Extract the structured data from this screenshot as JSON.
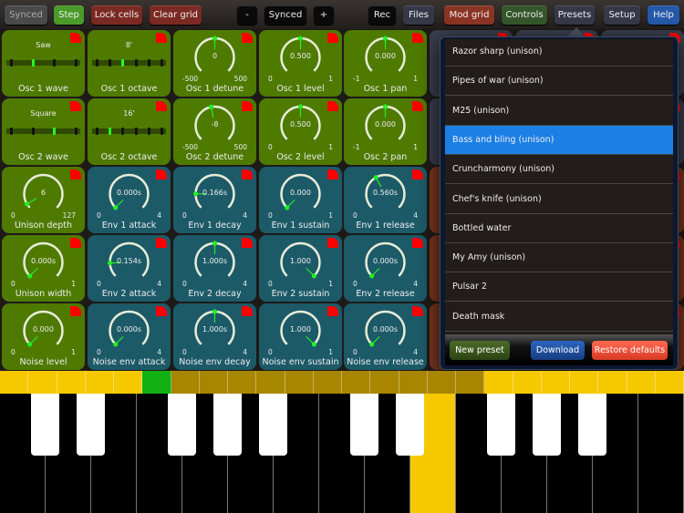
{
  "toolbar": {
    "left": [
      {
        "label": "Synced",
        "color": "#4a4a4a"
      },
      {
        "label": "Step",
        "color": "#4a9a2a"
      },
      {
        "label": "Lock cells",
        "color": "#7a2a22"
      },
      {
        "label": "Clear grid",
        "color": "#7a2a22"
      }
    ],
    "tempo": {
      "minus": "-",
      "value": "Synced",
      "plus": "+"
    },
    "right": [
      {
        "label": "Rec",
        "color": "#0a0a0a"
      },
      {
        "label": "Files",
        "color": "#363848"
      },
      {
        "label": "Mod grid",
        "color": "#8a3424"
      },
      {
        "label": "Controls",
        "color": "#35552a"
      },
      {
        "label": "Presets",
        "color": "#363848"
      },
      {
        "label": "Setup",
        "color": "#363848"
      },
      {
        "label": "Help",
        "color": "#2458a8"
      }
    ]
  },
  "colors": {
    "green": "#4e7a00",
    "teal": "#1c5a68",
    "brown": "#7a3520",
    "slate": "#383e4c",
    "pointer": "#22ee22",
    "flag": "#ff0000"
  },
  "grid": [
    [
      {
        "type": "slider",
        "value": "Saw",
        "ticks": 4,
        "pos": 1,
        "name": "Osc 1 wave",
        "color": "green"
      },
      {
        "type": "slider",
        "value": "8'",
        "ticks": 6,
        "pos": 2,
        "name": "Osc 1 octave",
        "color": "green"
      },
      {
        "type": "knob",
        "value": "0",
        "min": "-500",
        "max": "500",
        "fraction": 0.5,
        "name": "Osc 1 detune",
        "color": "green"
      },
      {
        "type": "knob",
        "value": "0.500",
        "min": "0",
        "max": "1",
        "fraction": 0.5,
        "name": "Osc 1 level",
        "color": "green"
      },
      {
        "type": "knob",
        "value": "0.000",
        "min": "-1",
        "max": "1",
        "fraction": 0.5,
        "name": "Osc 1 pan",
        "color": "green"
      }
    ],
    [
      {
        "type": "slider",
        "value": "Square",
        "ticks": 4,
        "pos": 2,
        "name": "Osc 2 wave",
        "color": "green"
      },
      {
        "type": "slider",
        "value": "16'",
        "ticks": 6,
        "pos": 1,
        "name": "Osc 2 octave",
        "color": "green"
      },
      {
        "type": "knob",
        "value": "-8",
        "min": "-500",
        "max": "500",
        "fraction": 0.46,
        "name": "Osc 2 detune",
        "color": "green"
      },
      {
        "type": "knob",
        "value": "0.500",
        "min": "0",
        "max": "1",
        "fraction": 0.5,
        "name": "Osc 2 level",
        "color": "green"
      },
      {
        "type": "knob",
        "value": "0.000",
        "min": "-1",
        "max": "1",
        "fraction": 0.5,
        "name": "Osc 2 pan",
        "color": "green"
      }
    ],
    [
      {
        "type": "knob",
        "value": "6",
        "min": "0",
        "max": "127",
        "fraction": 0.05,
        "name": "Unison depth",
        "color": "green"
      },
      {
        "type": "knob",
        "value": "0.000s",
        "min": "0",
        "max": "4",
        "fraction": 0,
        "name": "Env 1 attack",
        "color": "teal"
      },
      {
        "type": "knob",
        "value": "0.166s",
        "min": "0",
        "max": "4",
        "fraction": 0.17,
        "name": "Env 1 decay",
        "color": "teal"
      },
      {
        "type": "knob",
        "value": "0.000",
        "min": "0",
        "max": "1",
        "fraction": 0,
        "name": "Env 1 sustain",
        "color": "teal"
      },
      {
        "type": "knob",
        "value": "0.560s",
        "min": "0",
        "max": "4",
        "fraction": 0.39,
        "name": "Env 1 release",
        "color": "teal"
      }
    ],
    [
      {
        "type": "knob",
        "value": "0.000s",
        "min": "0",
        "max": "1",
        "fraction": 0,
        "name": "Unison width",
        "color": "green"
      },
      {
        "type": "knob",
        "value": "0.154s",
        "min": "0",
        "max": "4",
        "fraction": 0.16,
        "name": "Env 2 attack",
        "color": "teal"
      },
      {
        "type": "knob",
        "value": "1.000s",
        "min": "0",
        "max": "4",
        "fraction": 0.5,
        "name": "Env 2 decay",
        "color": "teal"
      },
      {
        "type": "knob",
        "value": "1.000",
        "min": "0",
        "max": "1",
        "fraction": 1,
        "name": "Env 2 sustain",
        "color": "teal"
      },
      {
        "type": "knob",
        "value": "0.000s",
        "min": "0",
        "max": "4",
        "fraction": 0,
        "name": "Env 2 release",
        "color": "teal"
      }
    ],
    [
      {
        "type": "knob",
        "value": "0.000",
        "min": "0",
        "max": "1",
        "fraction": 0,
        "name": "Noise level",
        "color": "green"
      },
      {
        "type": "knob",
        "value": "0.000s",
        "min": "0",
        "max": "4",
        "fraction": 0,
        "name": "Noise env attack",
        "color": "teal"
      },
      {
        "type": "knob",
        "value": "1.000s",
        "min": "0",
        "max": "4",
        "fraction": 0.5,
        "name": "Noise env decay",
        "color": "teal"
      },
      {
        "type": "knob",
        "value": "1.000",
        "min": "0",
        "max": "1",
        "fraction": 1,
        "name": "Noise env sustain",
        "color": "teal"
      },
      {
        "type": "knob",
        "value": "0.000s",
        "min": "0",
        "max": "4",
        "fraction": 0,
        "name": "Noise env release",
        "color": "teal"
      }
    ]
  ],
  "presets": {
    "items": [
      "Razor sharp (unison)",
      "Pipes of war (unison)",
      "M25 (unison)",
      "Bass and bling (unison)",
      "Cruncharmony (unison)",
      "Chef's knife (unison)",
      "Bottled water",
      "My Amy (unison)",
      "Pulsar 2",
      "Death mask"
    ],
    "selected_index": 3,
    "new_label": "New preset",
    "download_label": "Download",
    "restore_label": "Restore defaults"
  },
  "keyboard": {
    "strip_colors": [
      "#f5c800",
      "#f5c800",
      "#f5c800",
      "#f5c800",
      "#f5c800",
      "#12b012",
      "#a88600",
      "#a88600",
      "#a88600",
      "#a88600",
      "#a88600",
      "#a88600",
      "#a88600",
      "#a88600",
      "#a88600",
      "#a88600",
      "#a88600",
      "#f5c800",
      "#f5c800",
      "#f5c800",
      "#f5c800",
      "#f5c800",
      "#f5c800",
      "#f5c800"
    ],
    "pressed_key_index": 9,
    "highlight": "#f5c800"
  }
}
